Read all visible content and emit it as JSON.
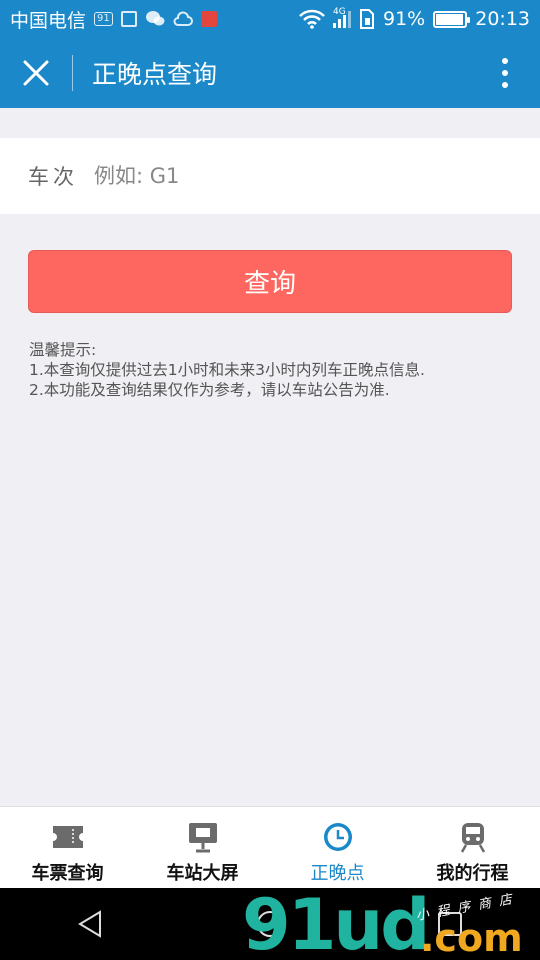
{
  "status_bar": {
    "carrier": "中国电信",
    "badge": "91",
    "network": "4G",
    "battery": "91%",
    "time": "20:13"
  },
  "header": {
    "title": "正晚点查询",
    "close_icon": "close-icon",
    "more_icon": "more-vertical-icon"
  },
  "form": {
    "label": "车次",
    "placeholder": "例如: G1",
    "value": ""
  },
  "query_button": {
    "label": "查询"
  },
  "tips": {
    "title": "温馨提示:",
    "lines": [
      "1.本查询仅提供过去1小时和未来3小时内列车正晚点信息.",
      "2.本功能及查询结果仅作为参考，请以车站公告为准."
    ]
  },
  "tabs": [
    {
      "label": "车票查询",
      "icon": "ticket-icon",
      "active": false
    },
    {
      "label": "车站大屏",
      "icon": "monitor-icon",
      "active": false
    },
    {
      "label": "正晚点",
      "icon": "clock-icon",
      "active": true
    },
    {
      "label": "我的行程",
      "icon": "train-icon",
      "active": false
    }
  ],
  "watermark": {
    "big": "91ud",
    "tld": ".com",
    "small": "小程序商店"
  },
  "colors": {
    "brand_blue": "#1b89c9",
    "button_red": "#fd6760",
    "background": "#efeff4"
  }
}
